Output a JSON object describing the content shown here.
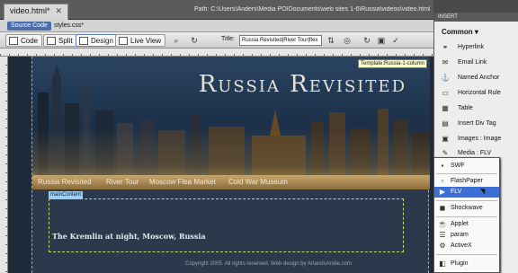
{
  "document": {
    "tab_label": "video.html*",
    "path": "Path: C:\\Users\\Anders\\Media POIDocuments\\web sites 1-6\\Russia\\videos\\video.html",
    "source_code_label": "Source Code",
    "related_file": "styles.css*"
  },
  "toolbar": {
    "code_label": "Code",
    "split_label": "Split",
    "design_label": "Design",
    "live_view_label": "Live View",
    "title_label": "Title:",
    "title_value": "Russia Revisited|River Tour|flex"
  },
  "design": {
    "site_title": "Russia Revisited",
    "template_tooltip": "Template:Russia-1-column",
    "nav_items": [
      "Russia Revisited",
      "River Tour",
      "Moscow Flea Market",
      "Cold War Museum"
    ],
    "main_content_label": "mainContent",
    "caption": "The Kremlin at night, Moscow, Russia",
    "copyright": "Copyright 2005. All rights reserved. Web design by ArtandsAndie.com"
  },
  "insert_panel": {
    "header": "INSERT",
    "category": "Common",
    "items": [
      {
        "label": "Hyperlink",
        "icon": "hyperlink-icon"
      },
      {
        "label": "Email Link",
        "icon": "email-icon"
      },
      {
        "label": "Named Anchor",
        "icon": "anchor-icon"
      },
      {
        "label": "Horizontal Rule",
        "icon": "rule-icon"
      },
      {
        "label": "Table",
        "icon": "table-icon"
      },
      {
        "label": "Insert Div Tag",
        "icon": "div-icon"
      },
      {
        "label": "Images : Image",
        "icon": "image-icon"
      },
      {
        "label": "Media : FLV",
        "icon": "media-icon"
      }
    ]
  },
  "media_menu": {
    "items": [
      {
        "label": "SWF",
        "icon": "swf-icon",
        "selected": false
      },
      {
        "label": "FlashPaper",
        "icon": "flashpaper-icon",
        "selected": false
      },
      {
        "label": "FLV",
        "icon": "flv-icon",
        "selected": true
      },
      {
        "label": "Shockwave",
        "icon": "shockwave-icon",
        "selected": false
      },
      {
        "label": "Applet",
        "icon": "applet-icon",
        "selected": false
      },
      {
        "label": "param",
        "icon": "param-icon",
        "selected": false
      },
      {
        "label": "ActiveX",
        "icon": "activex-icon",
        "selected": false
      },
      {
        "label": "Plugin",
        "icon": "plugin-icon",
        "selected": false
      }
    ]
  },
  "colors": {
    "selection": "#3b6fd6",
    "nav_gold": "#c9a66a",
    "header_blue": "#2b4462"
  }
}
